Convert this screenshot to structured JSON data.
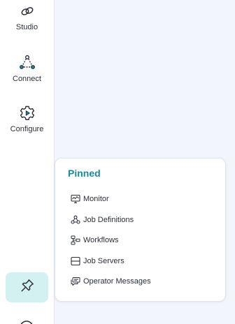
{
  "sidebar": {
    "items": [
      {
        "label": "Studio",
        "icon": "studio-icon"
      },
      {
        "label": "Connect",
        "icon": "connect-icon"
      },
      {
        "label": "Configure",
        "icon": "configure-icon"
      }
    ],
    "pin_icon": "pin-icon"
  },
  "pinned": {
    "title": "Pinned",
    "items": [
      {
        "label": "Monitor",
        "icon": "monitor-icon"
      },
      {
        "label": "Job Definitions",
        "icon": "job-definitions-icon"
      },
      {
        "label": "Workflows",
        "icon": "workflows-icon"
      },
      {
        "label": "Job Servers",
        "icon": "job-servers-icon"
      },
      {
        "label": "Operator Messages",
        "icon": "operator-messages-icon"
      }
    ]
  },
  "colors": {
    "accent": "#1b8a96",
    "pin_background": "#d4f1f2",
    "content_background": "#f2f5fb"
  }
}
